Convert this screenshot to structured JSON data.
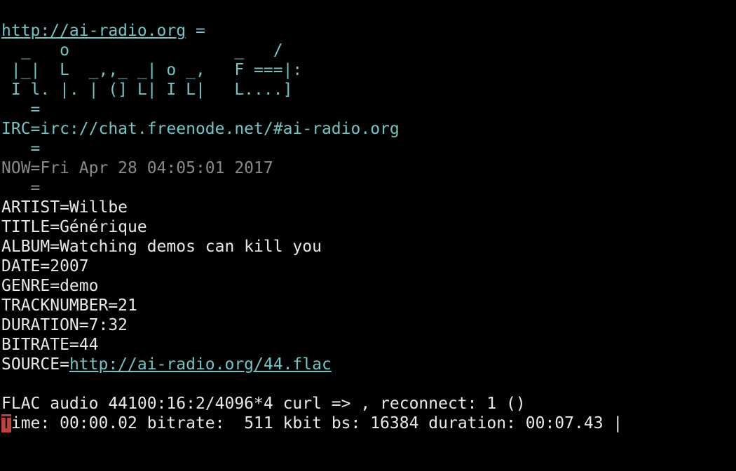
{
  "colors": {
    "background": "#000000",
    "foreground": "#e8e8e8",
    "accent_cyan": "#6fc6c6",
    "dim_gray": "#8a8a8a",
    "cursor": "#c0403a"
  },
  "header": {
    "url": "http://ai-radio.org",
    "url_suffix": " ="
  },
  "logo": {
    "lines": [
      "  _   o                 _   /",
      " |_|  L  _,,_ _| o _,   F ===|:",
      " I l. |. | (] L| I L|   L....]"
    ]
  },
  "separators": [
    "   =",
    "   =",
    "   ="
  ],
  "irc": {
    "label": "IRC=",
    "value": "irc://chat.freenode.net/#ai-radio.org"
  },
  "now": {
    "label": "NOW=",
    "value": "Fri Apr 28 04:05:01 2017"
  },
  "tags": {
    "artist": "ARTIST=Willbe",
    "title": "TITLE=Générique",
    "album": "ALBUM=Watching demos can kill you",
    "date": "DATE=2007",
    "genre": "GENRE=demo",
    "tracknumber": "TRACKNUMBER=21",
    "duration": "DURATION=7:32",
    "bitrate": "BITRATE=44",
    "source_label": "SOURCE=",
    "source_url": "http://ai-radio.org/44.flac"
  },
  "status": {
    "stream_info": "FLAC audio 44100:16:2/4096*4 curl => , reconnect: 1 ()",
    "cursor_char": "T",
    "progress": "ime: 00:00.02 bitrate:  511 kbit bs: 16384 duration: 00:07.43 |"
  }
}
